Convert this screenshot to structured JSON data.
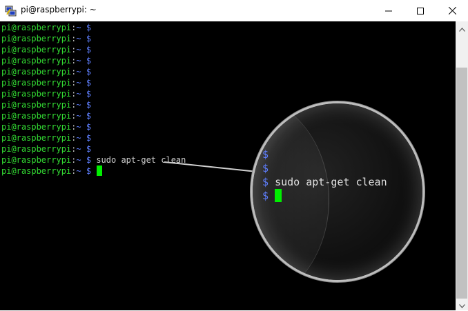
{
  "window": {
    "title": "pi@raspberrypi: ~",
    "icons": {
      "app": "putty-icon",
      "minimize": "minimize-icon",
      "maximize": "maximize-icon",
      "close": "close-icon"
    }
  },
  "terminal": {
    "prompt_user": "pi@raspberrypi",
    "prompt_sep": ":",
    "prompt_path": "~",
    "prompt_symbol": "$",
    "lines": [
      {
        "command": ""
      },
      {
        "command": ""
      },
      {
        "command": ""
      },
      {
        "command": ""
      },
      {
        "command": ""
      },
      {
        "command": ""
      },
      {
        "command": ""
      },
      {
        "command": ""
      },
      {
        "command": ""
      },
      {
        "command": ""
      },
      {
        "command": ""
      },
      {
        "command": ""
      },
      {
        "command": "sudo apt-get clean"
      },
      {
        "command": "",
        "cursor": true
      }
    ],
    "colors": {
      "user": "#33dd33",
      "path": "#5f7fff",
      "cursor": "#00ee00",
      "background": "#000000"
    }
  },
  "magnifier": {
    "lines": [
      {
        "symbol": "$",
        "command": ""
      },
      {
        "symbol": "$",
        "command": ""
      },
      {
        "symbol": "$",
        "command": "sudo apt-get clean"
      },
      {
        "symbol": "$",
        "command": "",
        "cursor": true
      }
    ]
  }
}
